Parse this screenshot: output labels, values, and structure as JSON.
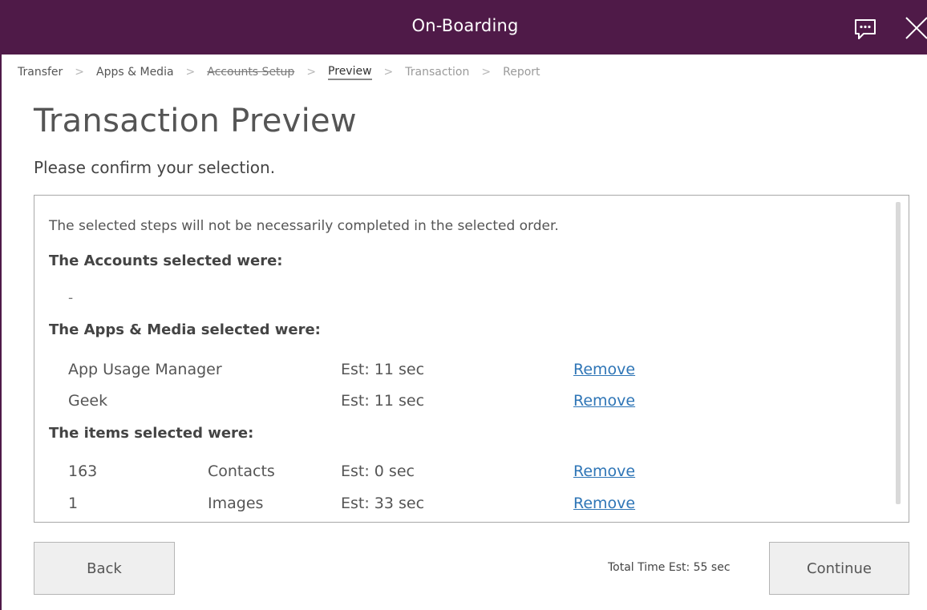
{
  "window": {
    "title": "On-Boarding"
  },
  "breadcrumb": {
    "steps": [
      {
        "label": "Transfer",
        "state": "done"
      },
      {
        "label": "Apps & Media",
        "state": "done"
      },
      {
        "label": "Accounts Setup",
        "state": "skipped"
      },
      {
        "label": "Preview",
        "state": "current"
      },
      {
        "label": "Transaction",
        "state": "future"
      },
      {
        "label": "Report",
        "state": "future"
      }
    ],
    "separator": ">"
  },
  "page": {
    "title": "Transaction Preview",
    "subtitle": "Please confirm your selection."
  },
  "summary": {
    "note": "The selected steps will not be necessarily completed in the selected order.",
    "accounts": {
      "heading": "The Accounts selected were:",
      "empty_value": "-"
    },
    "apps": {
      "heading": "The Apps & Media selected were:",
      "rows": [
        {
          "name": "App Usage Manager",
          "estimate": "Est: 11 sec",
          "action": "Remove"
        },
        {
          "name": "Geek",
          "estimate": "Est: 11 sec",
          "action": "Remove"
        }
      ]
    },
    "items": {
      "heading": "The items selected were:",
      "rows": [
        {
          "count": "163",
          "type": "Contacts",
          "estimate": "Est: 0 sec",
          "action": "Remove"
        },
        {
          "count": "1",
          "type": "Images",
          "estimate": "Est: 33 sec",
          "action": "Remove"
        }
      ]
    }
  },
  "footer": {
    "back_label": "Back",
    "total_time": "Total Time Est: 55 sec",
    "continue_label": "Continue"
  },
  "colors": {
    "titlebar": "#4f1a48",
    "link": "#2e75b6",
    "button_bg": "#efefef"
  },
  "icons": {
    "chat": "chat-bubble-icon",
    "close": "close-icon"
  }
}
